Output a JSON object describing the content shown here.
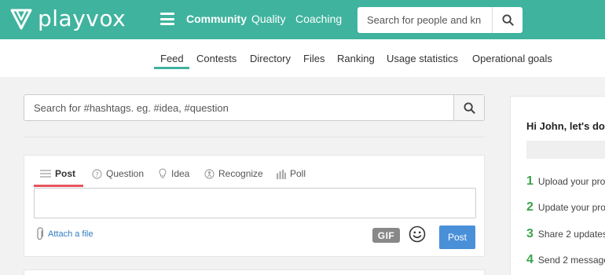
{
  "brand": {
    "name": "playvox",
    "color": "#3fb39e"
  },
  "topnav": {
    "items": [
      {
        "label": "Community",
        "active": true
      },
      {
        "label": "Quality",
        "active": false
      },
      {
        "label": "Coaching",
        "active": false
      }
    ],
    "search_placeholder": "Search for people and kn"
  },
  "subnav": {
    "items": [
      "Feed",
      "Contests",
      "Directory",
      "Files",
      "Ranking",
      "Usage statistics",
      "Operational goals"
    ],
    "active": "Feed"
  },
  "hashtag_search": {
    "placeholder": "Search for #hashtags. eg. #idea, #question"
  },
  "composer": {
    "tabs": [
      "Post",
      "Question",
      "Idea",
      "Recognize",
      "Poll"
    ],
    "active_tab": "Post",
    "attach_label": "Attach a file",
    "gif_label": "GIF",
    "post_label": "Post"
  },
  "onboarding": {
    "greeting": "Hi John, let's do",
    "steps": [
      {
        "num": "1",
        "text": "Upload your pro"
      },
      {
        "num": "2",
        "text": "Update your pro"
      },
      {
        "num": "3",
        "text": "Share 2 updates"
      },
      {
        "num": "4",
        "text": "Send 2 message"
      }
    ]
  },
  "colors": {
    "accent": "#3fb39e",
    "post_underline": "#e7545c",
    "post_button": "#4a90d9",
    "step_number": "#3ba34a"
  }
}
